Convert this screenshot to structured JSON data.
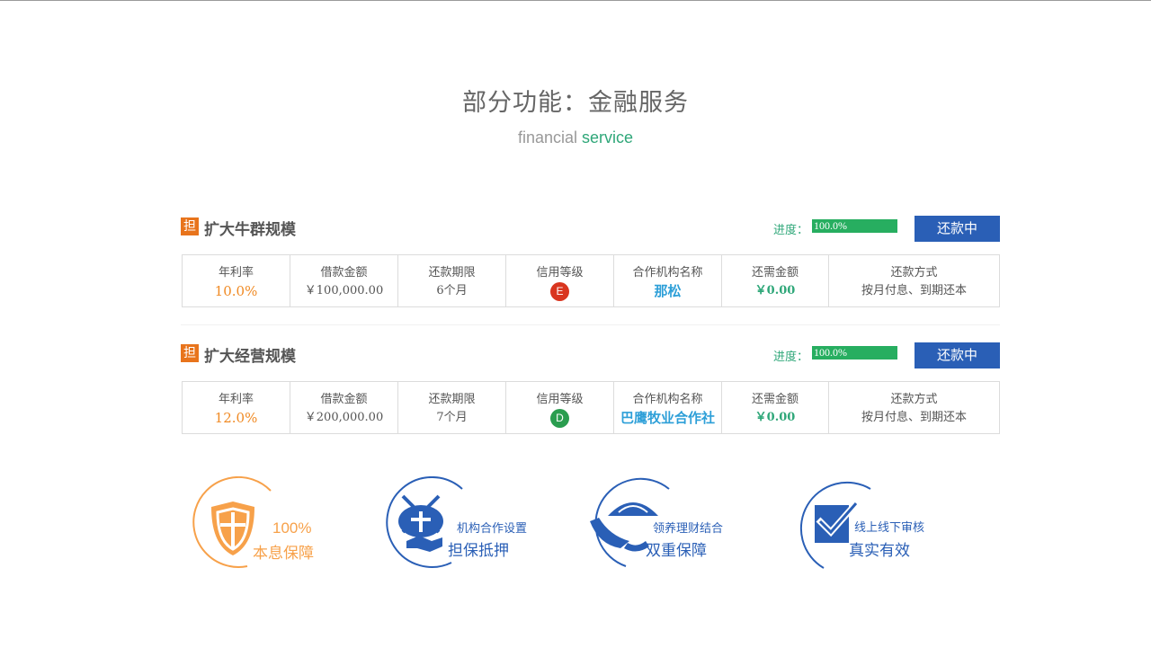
{
  "heading": {
    "title_cn": "部分功能：金融服务",
    "title_en_1": "financial",
    "title_en_2": "service"
  },
  "colors": {
    "accent_green": "#2fa779",
    "button_blue": "#2a5fb6",
    "tag_orange": "#e8741c",
    "badge_red": "#d9351f",
    "badge_green": "#2a9d4f",
    "feature_orange": "#f7a14a",
    "feature_blue": "#2a5fb6"
  },
  "loans": [
    {
      "tag": "担",
      "title": "扩大牛群规模",
      "progress_label": "进度：",
      "progress_text": "100.0%",
      "progress": 1.0,
      "status": "还款中",
      "columns": [
        {
          "header": "年利率",
          "value": "10.0%"
        },
        {
          "header": "借款金额",
          "value": "￥100,000.00"
        },
        {
          "header": "还款期限",
          "value": "6个月"
        },
        {
          "header": "信用等级",
          "value": "E"
        },
        {
          "header": "合作机构名称",
          "value": "那松"
        },
        {
          "header": "还需金额",
          "value": "￥0.00"
        },
        {
          "header": "还款方式",
          "value": "按月付息、到期还本"
        }
      ]
    },
    {
      "tag": "担",
      "title": "扩大经营规模",
      "progress_label": "进度：",
      "progress_text": "100.0%",
      "progress": 1.0,
      "status": "还款中",
      "columns": [
        {
          "header": "年利率",
          "value": "12.0%"
        },
        {
          "header": "借款金额",
          "value": "￥200,000.00"
        },
        {
          "header": "还款期限",
          "value": "7个月"
        },
        {
          "header": "信用等级",
          "value": "D"
        },
        {
          "header": "合作机构名称",
          "value": "巴鹰牧业合作社"
        },
        {
          "header": "还需金额",
          "value": "￥0.00"
        },
        {
          "header": "还款方式",
          "value": "按月付息、到期还本"
        }
      ]
    }
  ],
  "features": [
    {
      "icon": "shield-cross-icon",
      "line1": "100%",
      "line2": "本息保障"
    },
    {
      "icon": "handshake-icon",
      "line1": "机构合作设置",
      "line2": "担保抵押"
    },
    {
      "icon": "umbrella-icon",
      "line1": "领养理财结合",
      "line2": "双重保障"
    },
    {
      "icon": "checkmark-icon",
      "line1": "线上线下审核",
      "line2": "真实有效"
    }
  ]
}
